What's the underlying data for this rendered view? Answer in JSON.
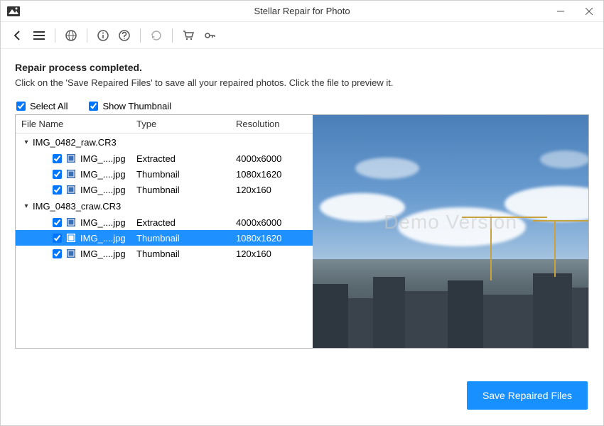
{
  "window": {
    "title": "Stellar Repair for Photo"
  },
  "content": {
    "heading": "Repair process completed.",
    "subheading": "Click on the 'Save Repaired Files' to save all your repaired photos. Click the file to preview it."
  },
  "options": {
    "select_all": "Select All",
    "show_thumbnail": "Show Thumbnail"
  },
  "columns": {
    "name": "File Name",
    "type": "Type",
    "resolution": "Resolution"
  },
  "groups": [
    {
      "name": "IMG_0482_raw.CR3",
      "files": [
        {
          "name": "IMG_....jpg",
          "type": "Extracted",
          "resolution": "4000x6000",
          "checked": true,
          "selected": false
        },
        {
          "name": "IMG_....jpg",
          "type": "Thumbnail",
          "resolution": "1080x1620",
          "checked": true,
          "selected": false
        },
        {
          "name": "IMG_....jpg",
          "type": "Thumbnail",
          "resolution": "120x160",
          "checked": true,
          "selected": false
        }
      ]
    },
    {
      "name": "IMG_0483_craw.CR3",
      "files": [
        {
          "name": "IMG_....jpg",
          "type": "Extracted",
          "resolution": "4000x6000",
          "checked": true,
          "selected": false
        },
        {
          "name": "IMG_....jpg",
          "type": "Thumbnail",
          "resolution": "1080x1620",
          "checked": true,
          "selected": true
        },
        {
          "name": "IMG_....jpg",
          "type": "Thumbnail",
          "resolution": "120x160",
          "checked": true,
          "selected": false
        }
      ]
    }
  ],
  "preview": {
    "watermark": "Demo Version"
  },
  "footer": {
    "save_label": "Save Repaired Files"
  }
}
